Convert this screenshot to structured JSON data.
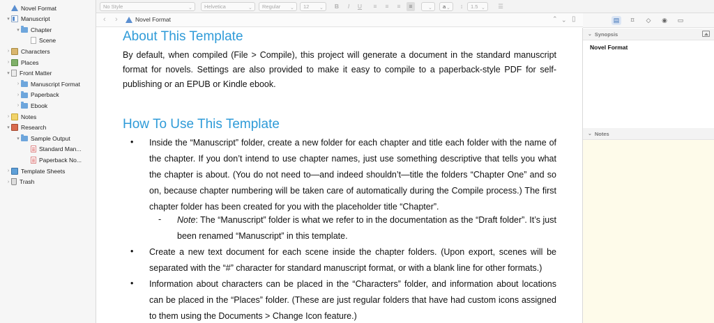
{
  "binder": {
    "items": [
      {
        "label": "Novel Format",
        "icon": "novel-format-icon",
        "indent": 0,
        "disclosure": ""
      },
      {
        "label": "Manuscript",
        "icon": "draft-folder-icon",
        "indent": 0,
        "disclosure": "▾"
      },
      {
        "label": "Chapter",
        "icon": "folder-icon",
        "indent": 1,
        "disclosure": "▾"
      },
      {
        "label": "Scene",
        "icon": "page-icon",
        "indent": 2,
        "disclosure": ""
      },
      {
        "label": "Characters",
        "icon": "characters-icon",
        "indent": 0,
        "disclosure": "›"
      },
      {
        "label": "Places",
        "icon": "places-icon",
        "indent": 0,
        "disclosure": "›"
      },
      {
        "label": "Front Matter",
        "icon": "front-matter-icon",
        "indent": 0,
        "disclosure": "▾"
      },
      {
        "label": "Manuscript Format",
        "icon": "folder-icon",
        "indent": 1,
        "disclosure": "›"
      },
      {
        "label": "Paperback",
        "icon": "folder-icon",
        "indent": 1,
        "disclosure": "›"
      },
      {
        "label": "Ebook",
        "icon": "folder-icon",
        "indent": 1,
        "disclosure": "›"
      },
      {
        "label": "Notes",
        "icon": "notes-icon",
        "indent": 0,
        "disclosure": "›"
      },
      {
        "label": "Research",
        "icon": "research-icon",
        "indent": 0,
        "disclosure": "▾"
      },
      {
        "label": "Sample Output",
        "icon": "folder-icon",
        "indent": 1,
        "disclosure": "▾"
      },
      {
        "label": "Standard Man...",
        "icon": "pdf-page-icon",
        "indent": 2,
        "disclosure": ""
      },
      {
        "label": "Paperback No...",
        "icon": "pdf-page-icon",
        "indent": 2,
        "disclosure": ""
      },
      {
        "label": "Template Sheets",
        "icon": "template-sheets-icon",
        "indent": 0,
        "disclosure": "›"
      },
      {
        "label": "Trash",
        "icon": "trash-icon",
        "indent": 0,
        "disclosure": "›"
      }
    ]
  },
  "formatbar": {
    "style": "No Style",
    "font": "Helvetica",
    "weight": "Regular",
    "size": "12",
    "bold": "B",
    "italic": "I",
    "underline": "U",
    "line_spacing": "1.5",
    "highlight_label": "a"
  },
  "editor_header": {
    "title": "Novel Format",
    "back": "‹",
    "forward": "›"
  },
  "document": {
    "heading1": "About This Template",
    "para1": "By default, when compiled (File > Compile), this project will generate a document in the standard manuscript format for novels. Settings are also provided to make it easy to compile to a paperback-style PDF for self-publishing or an EPUB or Kindle ebook.",
    "heading2": "How To Use This Template",
    "bullet_char": "•",
    "dash_char": "-",
    "list1": "Inside the “Manuscript” folder, create a new folder for each chapter and title each folder with the name of the chapter. If you don’t intend to use chapter names, just use something descriptive that tells you what the chapter is about. (You do not need to—and indeed shouldn’t—title the folders “Chapter One” and so on, because chapter numbering will be taken care of automatically during the Compile process.) The first chapter folder has been created for you with the placeholder title “Chapter”.",
    "note_label": "Note",
    "note_text": ": The “Manuscript” folder is what we refer to in the documentation as the “Draft folder”. It’s just been renamed “Manuscript” in this template.",
    "list2": "Create a new text document for each scene inside the chapter folders. (Upon export, scenes will be separated with the “#” character for standard manuscript format, or with a blank line for other formats.)",
    "list3": "Information about characters can be placed in the “Characters” folder, and information about locations can be placed in the “Places” folder. (These are just regular folders that have had custom icons assigned to them using the Documents > Change Icon feature.)"
  },
  "inspector": {
    "synopsis_header": "Synopsis",
    "synopsis_title": "Novel Format",
    "notes_header": "Notes"
  },
  "colors": {
    "heading": "#2f9bd8",
    "notes_bg": "#fefbea",
    "active_tab": "#dbe5f4"
  }
}
